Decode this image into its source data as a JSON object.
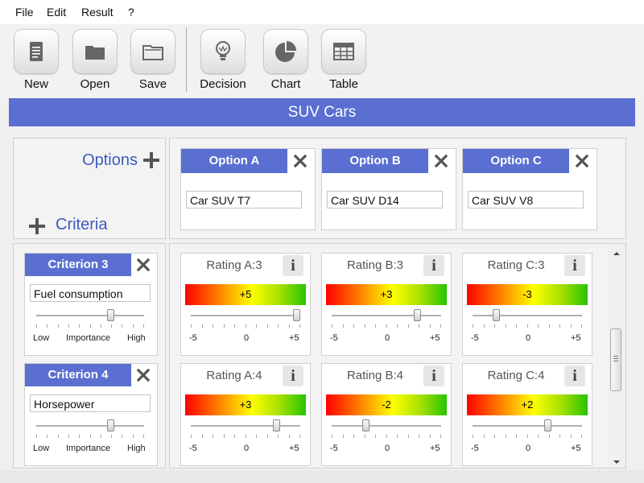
{
  "menu": [
    "File",
    "Edit",
    "Result",
    "?"
  ],
  "toolbar": {
    "new": "New",
    "open": "Open",
    "save": "Save",
    "decision": "Decision",
    "chart": "Chart",
    "table": "Table"
  },
  "title": "SUV Cars",
  "options_label": "Options",
  "criteria_label": "Criteria",
  "options": [
    {
      "header": "Option A",
      "value": "Car SUV T7"
    },
    {
      "header": "Option B",
      "value": "Car SUV D14"
    },
    {
      "header": "Option C",
      "value": "Car SUV V8"
    }
  ],
  "criteria": [
    {
      "header": "Criterion 3",
      "value": "Fuel consumption",
      "importance": 0.7,
      "ratings": [
        {
          "label": "Rating A:3",
          "value": 5,
          "display": "+5"
        },
        {
          "label": "Rating B:3",
          "value": 3,
          "display": "+3"
        },
        {
          "label": "Rating C:3",
          "value": -3,
          "display": "-3"
        }
      ]
    },
    {
      "header": "Criterion 4",
      "value": "Horsepower",
      "importance": 0.7,
      "ratings": [
        {
          "label": "Rating A:4",
          "value": 3,
          "display": "+3"
        },
        {
          "label": "Rating B:4",
          "value": -2,
          "display": "-2"
        },
        {
          "label": "Rating C:4",
          "value": 2,
          "display": "+2"
        }
      ]
    }
  ],
  "importance_labels": {
    "low": "Low",
    "mid": "Importance",
    "high": "High"
  },
  "scale": {
    "min": "-5",
    "mid": "0",
    "max": "+5",
    "min_value": -5,
    "max_value": 5
  },
  "info_glyph": "i",
  "colors": {
    "accent": "#5a6fd1",
    "label_blue": "#3d5bbf"
  },
  "icons": [
    "document-icon",
    "folder-icon",
    "folder-open-icon",
    "lightbulb-icon",
    "pie-chart-icon",
    "table-icon",
    "plus-icon",
    "close-icon",
    "info-icon"
  ]
}
